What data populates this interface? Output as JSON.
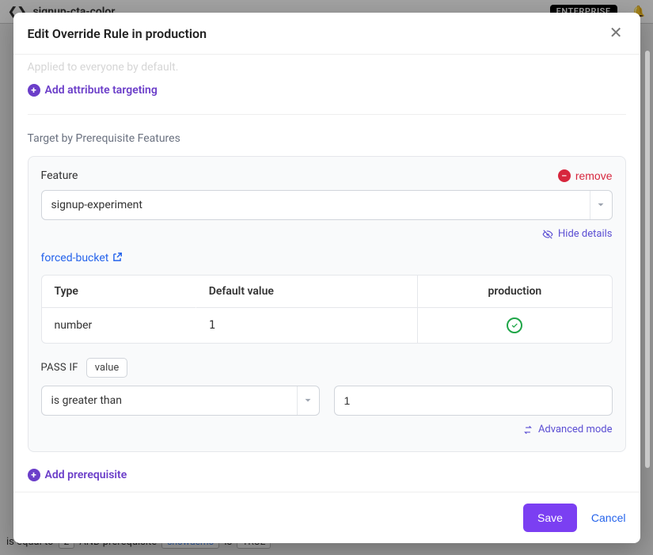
{
  "background": {
    "page_title": "signup-cta-color",
    "plan_badge": "ENTERPRISE",
    "bottom_text_1": "is equal to",
    "bottom_val": "2",
    "bottom_text_2": "AND prerequisite",
    "bottom_link": "showdemo",
    "bottom_text_3": "is",
    "bottom_true": "TRUE"
  },
  "modal": {
    "title": "Edit Override Rule in production",
    "applied_text": "Applied to everyone by default.",
    "add_attr": "Add attribute targeting",
    "section_title": "Target by Prerequisite Features",
    "feature_label": "Feature",
    "remove_label": "remove",
    "feature_value": "signup-experiment",
    "hide_details": "Hide details",
    "linked_feature": "forced-bucket",
    "table": {
      "headers": [
        "Type",
        "Default value",
        "production"
      ],
      "row": {
        "type": "number",
        "default": "1"
      }
    },
    "pass_if_label": "PASS IF",
    "pass_if_pill": "value",
    "operator": "is greater than",
    "compare_value": "1",
    "advanced": "Advanced mode",
    "add_prereq": "Add prerequisite",
    "save": "Save",
    "cancel": "Cancel"
  }
}
